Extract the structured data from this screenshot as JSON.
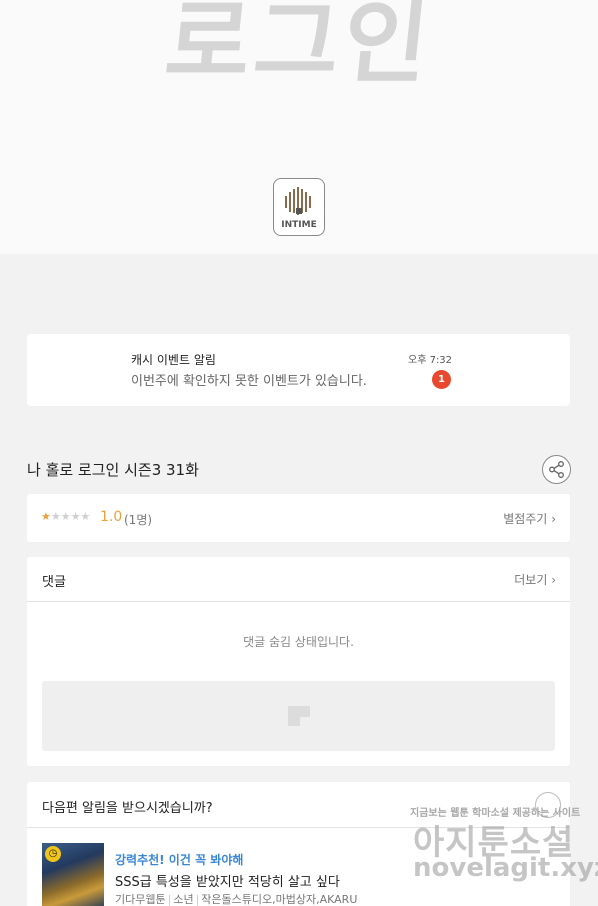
{
  "hero": {
    "title": "로그인",
    "publisher": "INTIME"
  },
  "notice": {
    "title": "캐시 이벤트 알림",
    "body": "이번주에 확인하지 못한 이벤트가 있습니다.",
    "time": "오후 7:32",
    "badge": "1"
  },
  "episode": {
    "title": "나 홀로 로그인 시즌3 31화",
    "share_icon": "share-icon"
  },
  "rating": {
    "stars_filled_fraction": 0.2,
    "score": "1.0",
    "count": "(1명)",
    "rate_label": "별점주기",
    "rate_chevron": "›"
  },
  "comments": {
    "title": "댓글",
    "more_label": "더보기",
    "more_chevron": "›",
    "hidden_text": "댓글 숨김 상태입니다."
  },
  "alert": {
    "question": "다음편 알림을 받으시겠습니까?",
    "rec_tag": "강력추천! 이건 꼭 봐야해",
    "rec_title": "SSS급 특성을 받았지만 적당히 살고 싶다",
    "rec_meta": [
      "기다무웹툰",
      "소년",
      "작은돌스튜디오,마법상자,AKARU"
    ]
  },
  "watermark": {
    "small": "지금보는 웹툰 학마소설 제공하는 사이트",
    "big": "아지툰소설",
    "url": "novelagit.xyz"
  },
  "colors": {
    "accent": "#e8a23b",
    "badge": "#e8492e",
    "link": "#3a87d8"
  }
}
